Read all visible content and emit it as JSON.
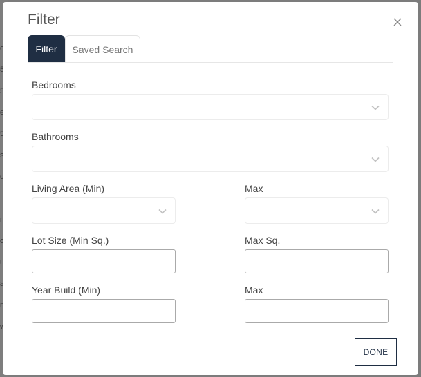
{
  "modal": {
    "title": "Filter",
    "close_icon": "close-icon"
  },
  "tabs": [
    {
      "label": "Filter",
      "active": true
    },
    {
      "label": "Saved Search",
      "active": false
    }
  ],
  "fields": {
    "bedrooms": {
      "label": "Bedrooms",
      "value": ""
    },
    "bathrooms": {
      "label": "Bathrooms",
      "value": ""
    },
    "living_area_min": {
      "label": "Living Area (Min)",
      "value": ""
    },
    "living_area_max": {
      "label": "Max",
      "value": ""
    },
    "lot_size_min": {
      "label": "Lot Size (Min Sq.)",
      "value": ""
    },
    "lot_size_max": {
      "label": "Max Sq.",
      "value": ""
    },
    "year_build_min": {
      "label": "Year Build (Min)",
      "value": ""
    },
    "year_build_max": {
      "label": "Max",
      "value": ""
    }
  },
  "done_label": "DONE",
  "backdrop_chars": [
    "o",
    "5",
    "5",
    "e",
    "5",
    "s",
    "d",
    "n",
    "o",
    "u",
    "a",
    "n",
    "w"
  ],
  "colors": {
    "accent": "#1f2e43",
    "backdrop": "#7c7c7c"
  }
}
